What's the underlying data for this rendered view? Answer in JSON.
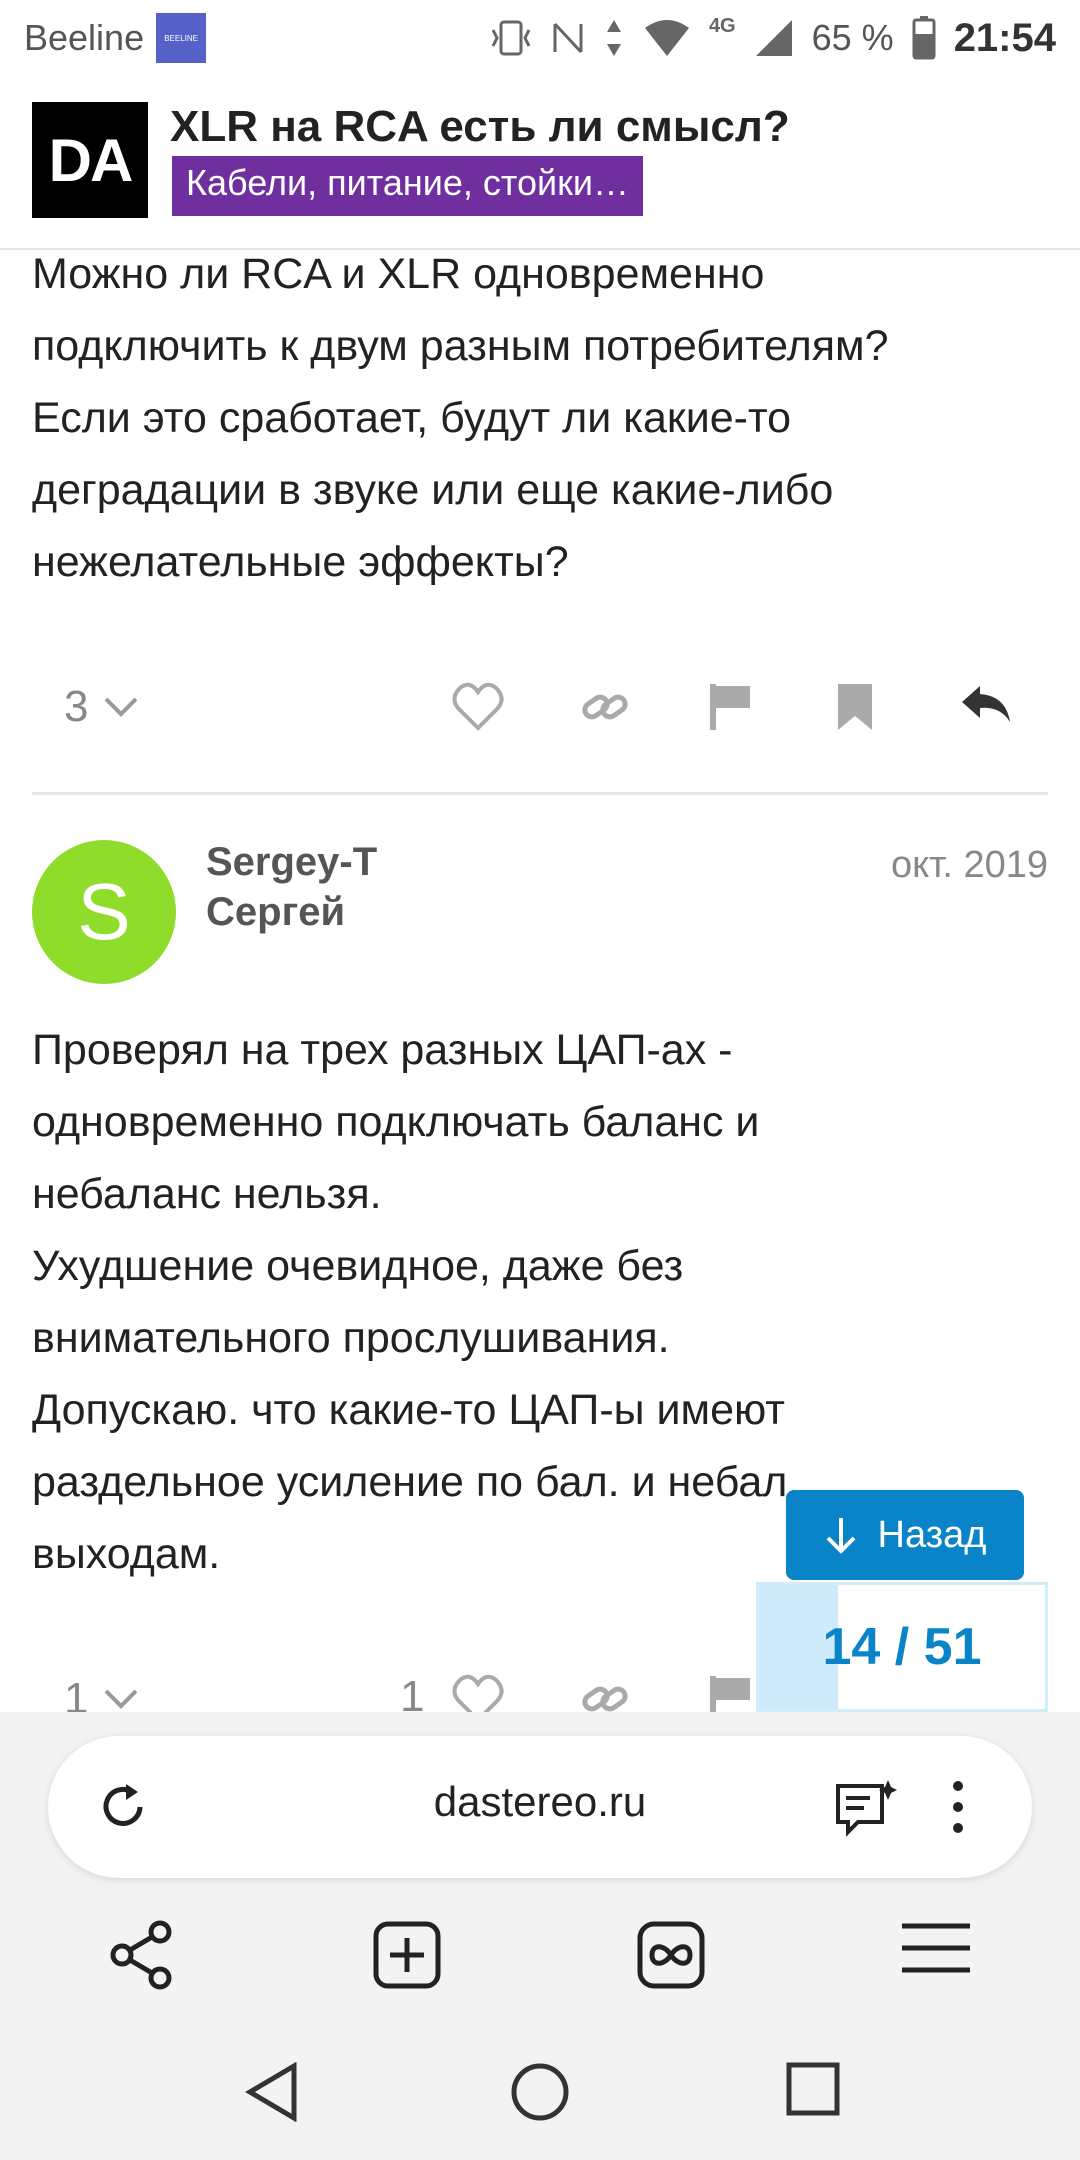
{
  "status_bar": {
    "carrier": "Beeline",
    "sim_badge": "BEELINE",
    "battery": "65 %",
    "time": "21:54",
    "network": "4G"
  },
  "header": {
    "logo": "DA",
    "title": "XLR на RCA есть ли смысл?",
    "category": "Кабели, питание, стойки…",
    "category_color": "#6f2f9f"
  },
  "post1": {
    "lines": [
      "Можно ли RCA и XLR одновременно",
      "подключить к двум разным потребителям?",
      "Если это сработает, будут ли какие-то",
      "деградации в звуке или еще какие-либо",
      "нежелательные эффекты?"
    ],
    "replies_count": "3",
    "icons": [
      "heart-icon",
      "link-icon",
      "flag-icon",
      "bookmark-icon",
      "reply-icon"
    ]
  },
  "post2": {
    "avatar_letter": "S",
    "avatar_color": "#8fdc2a",
    "username": "Sergey-T",
    "fullname": "Сергей",
    "date": "окт. 2019",
    "lines": [
      "Проверял на трех разных ЦАП-ах -",
      "одновременно подключать баланс и",
      "небаланс нельзя.",
      "Ухудшение очевидное, даже без",
      "внимательного прослушивания.",
      "Допускаю. что какие-то ЦАП-ы имеют",
      "раздельное усиление по бал. и небал",
      "выходам."
    ],
    "replies_count": "1",
    "likes_count": "1"
  },
  "navigation": {
    "back_label": "Назад",
    "progress_text": "14 / 51",
    "progress_fraction": 0.2745,
    "accent_color": "#0a84c8"
  },
  "browser": {
    "url": "dastereo.ru"
  }
}
